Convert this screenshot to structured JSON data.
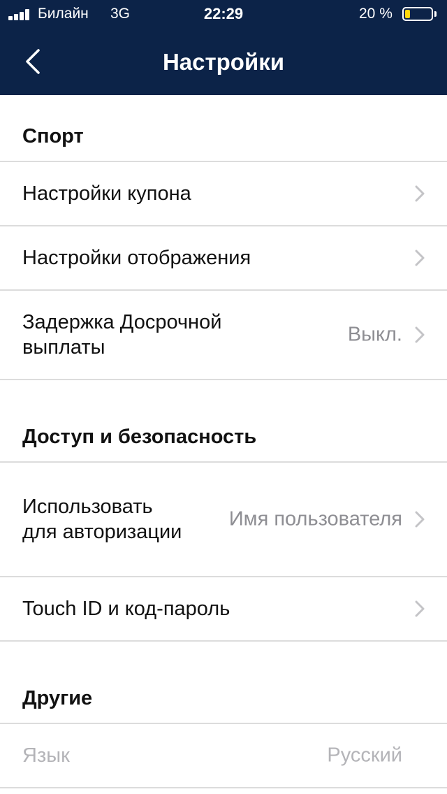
{
  "status_bar": {
    "carrier": "Билайн",
    "network": "3G",
    "time": "22:29",
    "battery_percent_text": "20 %",
    "battery_level": 0.2,
    "battery_color": "#ffd60a"
  },
  "navbar": {
    "title": "Настройки",
    "back_icon": "chevron-left-icon",
    "background_color": "#0c2348"
  },
  "sections": {
    "sport": {
      "title": "Спорт",
      "items": [
        {
          "label": "Настройки купона",
          "value": ""
        },
        {
          "label": "Настройки отображения",
          "value": ""
        },
        {
          "label": "Задержка Досрочной выплаты",
          "value": "Выкл."
        }
      ]
    },
    "access": {
      "title": "Доступ и безопасность",
      "items": [
        {
          "label": "Использовать для авторизации",
          "value": "Имя пользователя"
        },
        {
          "label": "Touch ID и код-пароль",
          "value": ""
        }
      ]
    },
    "other": {
      "title": "Другие",
      "items": [
        {
          "label": "Язык",
          "value": "Русский",
          "disabled": true
        }
      ]
    }
  }
}
